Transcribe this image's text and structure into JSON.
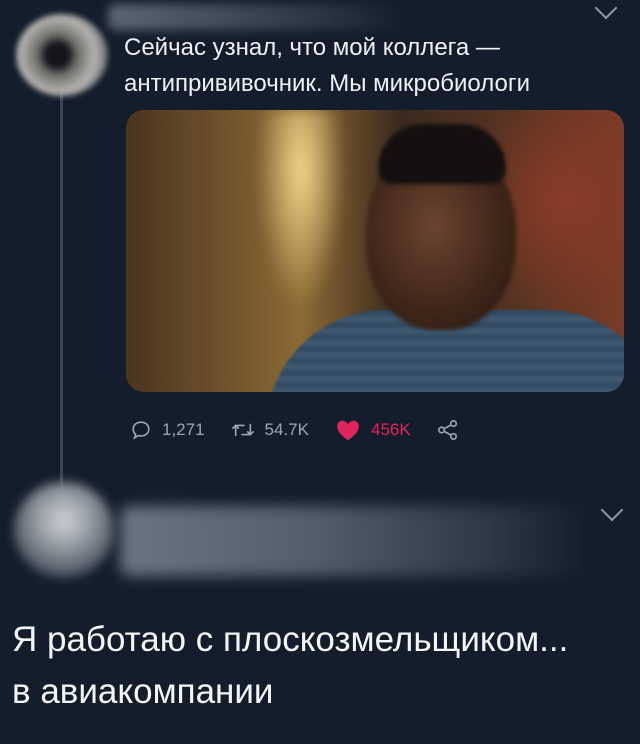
{
  "tweet": {
    "text": "Сейчас узнал, что мой коллега —\nантипрививочник. Мы микробиологи",
    "media_icon": "video-still",
    "stats": {
      "replies": "1,271",
      "retweets": "54.7K",
      "likes": "456K"
    }
  },
  "reply": {
    "text": "Я работаю с плоскозмельщиком...\nв авиакомпании"
  },
  "icons": {
    "more": "chevron-down-icon",
    "reply": "comment-icon",
    "retweet": "retweet-icon",
    "like": "heart-icon",
    "share": "share-icon"
  },
  "colors": {
    "background": "#141d2b",
    "like": "#e0245e",
    "muted": "#9aa6b4"
  }
}
